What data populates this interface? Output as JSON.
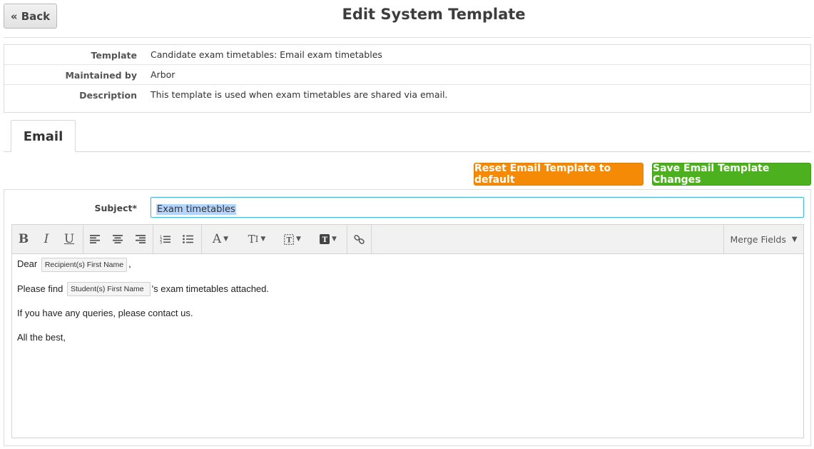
{
  "header": {
    "back_label": "« Back",
    "title": "Edit System Template"
  },
  "info": {
    "rows": [
      {
        "label": "Template",
        "value": "Candidate exam timetables: Email exam timetables"
      },
      {
        "label": "Maintained by",
        "value": "Arbor"
      },
      {
        "label": "Description",
        "value": "This template is used when exam timetables are shared via email."
      }
    ]
  },
  "tabs": [
    {
      "label": "Email",
      "active": true
    }
  ],
  "actions": {
    "reset_label": "Reset Email Template to default",
    "save_label": "Save Email Template Changes",
    "reset_color": "#f58a07",
    "save_color": "#4db01e"
  },
  "form": {
    "subject_label": "Subject*",
    "subject_value": "Exam timetables"
  },
  "editor": {
    "toolbar": {
      "icons": [
        "bold-icon",
        "italic-icon",
        "underline-icon",
        "align-left-icon",
        "align-center-icon",
        "align-right-icon",
        "ordered-list-icon",
        "unordered-list-icon",
        "font-color-icon",
        "font-size-icon",
        "format-icon",
        "text-style-icon",
        "link-icon"
      ],
      "merge_fields_label": "Merge Fields"
    },
    "body": {
      "line1_prefix": "Dear",
      "line1_tag": "Recipient(s) First Name",
      "line1_suffix": ",",
      "line2_prefix": "Please find",
      "line2_tag": "Student(s) First Name",
      "line2_suffix": "'s exam timetables attached.",
      "line3": "If you have any queries, please contact us.",
      "line4": "All the best,"
    }
  }
}
